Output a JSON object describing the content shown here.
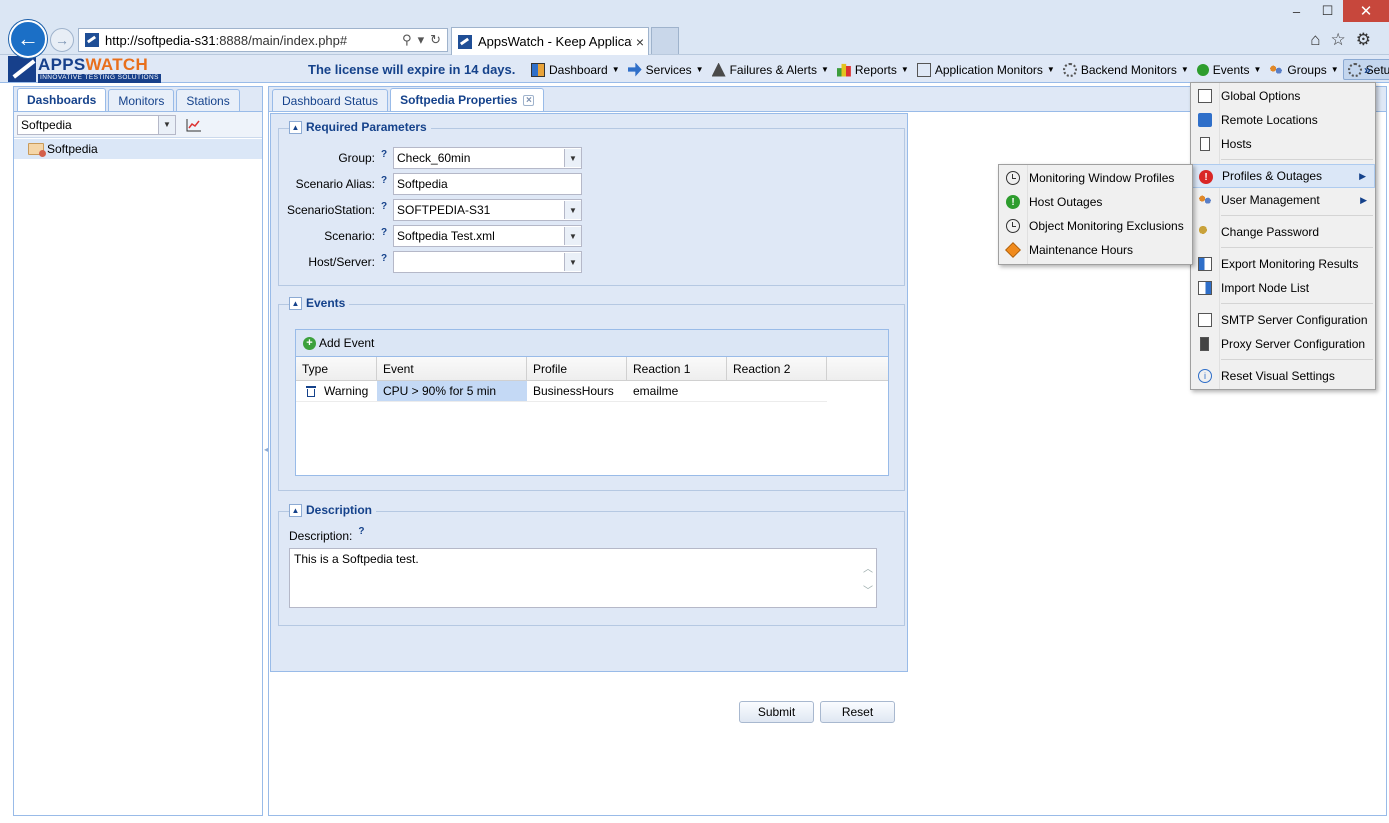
{
  "browser": {
    "url_prefix": "http://softpedia-s31",
    "url_suffix": ":8888/main/index.php#",
    "tab_title": "AppsWatch - Keep Applicat...",
    "tab_close": "×",
    "win_min": "‒",
    "win_max": "☐",
    "win_close": "✕",
    "home": "⌂",
    "favorites": "☆",
    "tools": "⚙",
    "search_glyph": "⚲",
    "dropdown_glyph": "▾",
    "refresh_glyph": "↻",
    "back_glyph": "←",
    "forward_glyph": "→"
  },
  "header": {
    "brand_apps": "APPS",
    "brand_watch": "WATCH",
    "tagline": "INNOVATIVE TESTING SOLUTIONS",
    "license_message": "The license will expire in 14 days.",
    "overflow": "»"
  },
  "main_menu": [
    {
      "label": "Dashboard",
      "icon": "dashboard-icon"
    },
    {
      "label": "Services",
      "icon": "services-icon"
    },
    {
      "label": "Failures & Alerts",
      "icon": "warning-icon"
    },
    {
      "label": "Reports",
      "icon": "reports-icon"
    },
    {
      "label": "Application Monitors",
      "icon": "application-monitors-icon"
    },
    {
      "label": "Backend Monitors",
      "icon": "backend-monitors-icon"
    },
    {
      "label": "Events",
      "icon": "events-icon"
    },
    {
      "label": "Groups",
      "icon": "groups-icon"
    },
    {
      "label": "Setup",
      "icon": "gear-icon"
    }
  ],
  "left_panel": {
    "tabs": [
      "Dashboards",
      "Monitors",
      "Stations"
    ],
    "combo_value": "Softpedia",
    "tree_item": "Softpedia"
  },
  "right_panel": {
    "tabs": [
      "Dashboard Status",
      "Softpedia Properties"
    ]
  },
  "form": {
    "required_title": "Required Parameters",
    "help_glyph": "?",
    "fields": {
      "group": {
        "label": "Group:",
        "value": "Check_60min"
      },
      "scenario_alias": {
        "label": "Scenario Alias:",
        "value": "Softpedia"
      },
      "scenario_station": {
        "label": "ScenarioStation:",
        "value": "SOFTPEDIA-S31"
      },
      "scenario": {
        "label": "Scenario:",
        "value": "Softpedia Test.xml"
      },
      "host_server": {
        "label": "Host/Server:",
        "value": ""
      }
    },
    "events_title": "Events",
    "add_event": "Add Event",
    "grid_columns": [
      "Type",
      "Event",
      "Profile",
      "Reaction 1",
      "Reaction 2"
    ],
    "grid_rows": [
      {
        "type": "Warning",
        "event": "CPU > 90% for 5 min",
        "profile": "BusinessHours",
        "reaction1": "emailme",
        "reaction2": ""
      }
    ],
    "description_title": "Description",
    "description_label": "Description:",
    "description_value": "This is a Softpedia test.",
    "submit": "Submit",
    "reset": "Reset"
  },
  "setup_menu": [
    {
      "label": "Global Options",
      "icon": "global-options-icon"
    },
    {
      "label": "Remote Locations",
      "icon": "remote-locations-icon"
    },
    {
      "label": "Hosts",
      "icon": "hosts-icon"
    },
    {
      "label": "Profiles & Outages",
      "icon": "profiles-outages-icon",
      "submenu": true
    },
    {
      "label": "User Management",
      "icon": "user-management-icon",
      "submenu": true
    },
    {
      "label": "Change Password",
      "icon": "key-icon"
    },
    {
      "label": "Export Monitoring Results",
      "icon": "export-icon"
    },
    {
      "label": "Import Node List",
      "icon": "import-icon"
    },
    {
      "label": "SMTP Server Configuration",
      "icon": "smtp-icon"
    },
    {
      "label": "Proxy Server Configuration",
      "icon": "proxy-icon"
    },
    {
      "label": "Reset Visual Settings",
      "icon": "info-icon"
    }
  ],
  "profiles_submenu": [
    {
      "label": "Monitoring Window Profiles",
      "icon": "clock-icon"
    },
    {
      "label": "Host Outages",
      "icon": "host-outages-icon"
    },
    {
      "label": "Object Monitoring Exclusions",
      "icon": "clock-exclusion-icon"
    },
    {
      "label": "Maintenance Hours",
      "icon": "maintenance-icon"
    }
  ],
  "colors": {
    "accent": "#15428b",
    "panel_bg": "#dfe8f6",
    "border": "#99bbe8",
    "brand_orange": "#e86f1c",
    "brand_blue": "#17408b"
  }
}
